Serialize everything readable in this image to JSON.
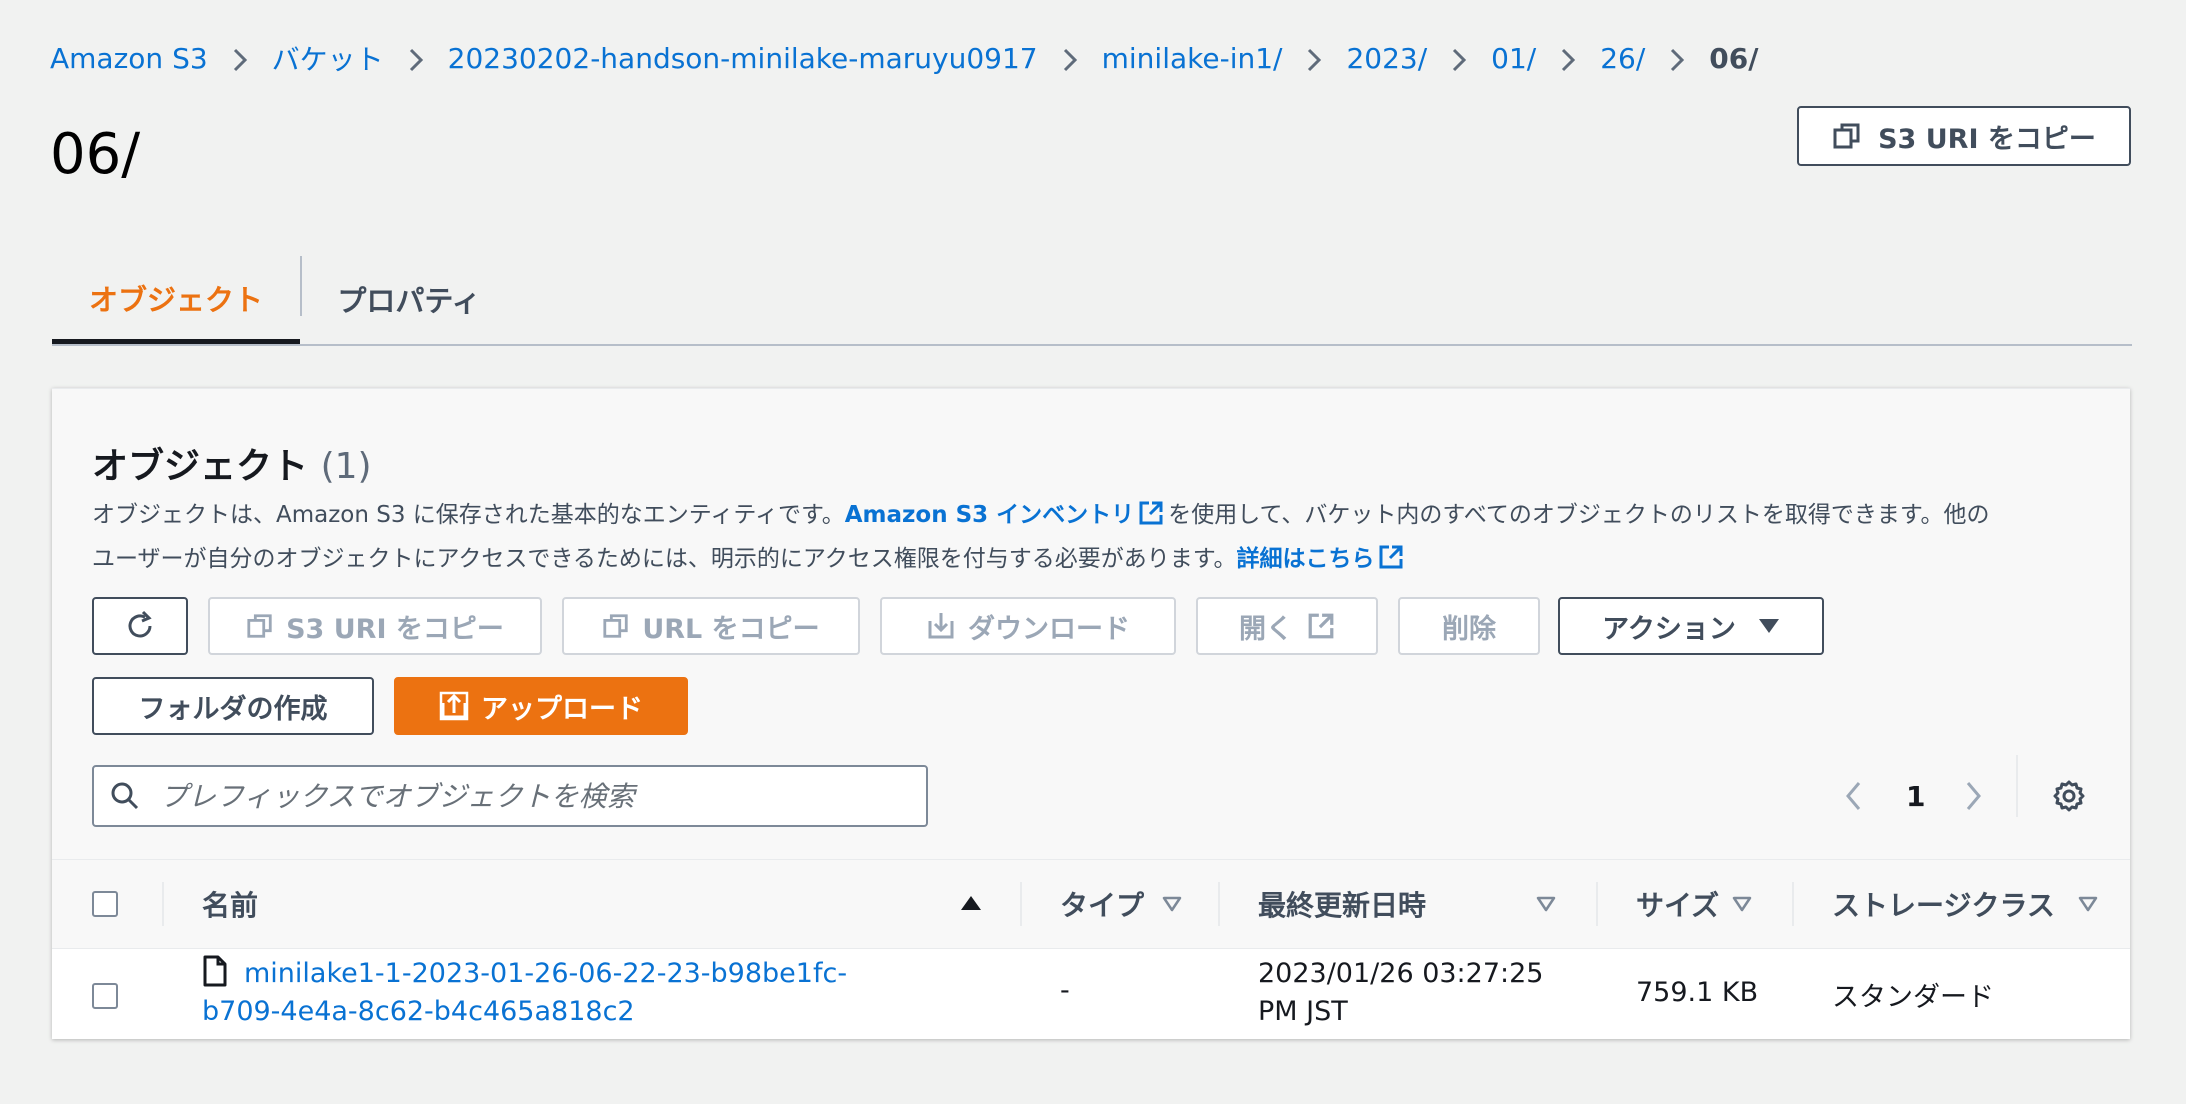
{
  "breadcrumb": {
    "items": [
      "Amazon S3",
      "バケット",
      "20230202-handson-minilake-maruyu0917",
      "minilake-in1/",
      "2023/",
      "01/",
      "26/"
    ],
    "current": "06/"
  },
  "page": {
    "title": "06/",
    "copy_uri_label": "S3 URI をコピー"
  },
  "tabs": [
    {
      "label": "オブジェクト",
      "active": true
    },
    {
      "label": "プロパティ",
      "active": false
    }
  ],
  "objects_panel": {
    "title": "オブジェクト",
    "count": "(1)",
    "desc_part1": "オブジェクトは、Amazon S3 に保存された基本的なエンティティです。",
    "desc_link1": "Amazon S3 インベントリ",
    "desc_part2": "を使用して、バケット内のすべてのオブジェクトのリストを取得できます。他の",
    "desc_part3": "ユーザーが自分のオブジェクトにアクセスできるためには、明示的にアクセス権限を付与する必要があります。",
    "desc_link2": "詳細はこちら"
  },
  "toolbar": {
    "copy_s3_uri": "S3 URI をコピー",
    "copy_url": "URL をコピー",
    "download": "ダウンロード",
    "open": "開く",
    "delete": "削除",
    "actions": "アクション",
    "create_folder": "フォルダの作成",
    "upload": "アップロード"
  },
  "search": {
    "placeholder": "プレフィックスでオブジェクトを検索"
  },
  "pagination": {
    "page": "1"
  },
  "table": {
    "columns": [
      "名前",
      "タイプ",
      "最終更新日時",
      "サイズ",
      "ストレージクラス"
    ],
    "rows": [
      {
        "name_line1": "minilake1-1-2023-01-26-06-22-23-b98be1fc-",
        "name_line2": "b709-4e4a-8c62-b4c465a818c2",
        "type": "-",
        "modified_line1": "2023/01/26 03:27:25",
        "modified_line2": "PM JST",
        "size": "759.1 KB",
        "storage_class": "スタンダード"
      }
    ]
  },
  "colors": {
    "link": "#0972d3",
    "accent_orange": "#ec7211",
    "text_dark": "#16191f",
    "text_muted": "#414d5c",
    "background": "#f1f2f1"
  }
}
